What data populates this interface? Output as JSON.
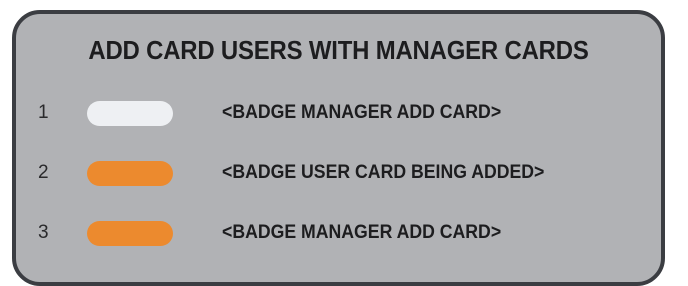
{
  "title": "ADD CARD USERS WITH MANAGER CARDS",
  "colors": {
    "panel_background": "#b1b2b5",
    "panel_border": "#3b3d42",
    "manager_badge": "#eef0f3",
    "user_badge": "#ec8a2e"
  },
  "steps": [
    {
      "number": "1",
      "badge_icon": "white-badge-card-icon",
      "badge_color": "#eef0f3",
      "label": "<BADGE MANAGER ADD CARD>"
    },
    {
      "number": "2",
      "badge_icon": "orange-badge-card-icon",
      "badge_color": "#ec8a2e",
      "label": "<BADGE USER CARD BEING ADDED>"
    },
    {
      "number": "3",
      "badge_icon": "orange-badge-card-icon",
      "badge_color": "#ec8a2e",
      "label": "<BADGE MANAGER ADD CARD>"
    }
  ]
}
